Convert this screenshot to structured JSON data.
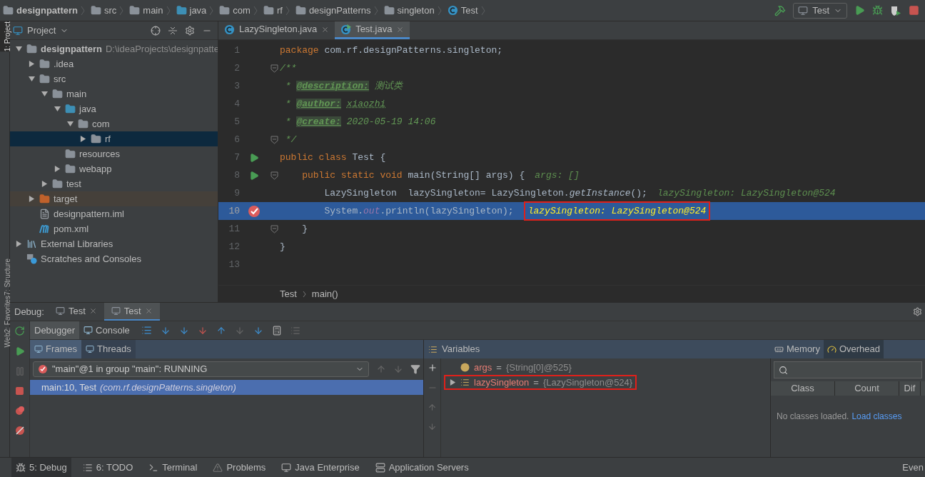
{
  "breadcrumbs": [
    {
      "label": "designpattern",
      "kind": "module"
    },
    {
      "label": "src",
      "kind": "folder"
    },
    {
      "label": "main",
      "kind": "folder"
    },
    {
      "label": "java",
      "kind": "source"
    },
    {
      "label": "com",
      "kind": "package"
    },
    {
      "label": "rf",
      "kind": "package"
    },
    {
      "label": "designPatterns",
      "kind": "package"
    },
    {
      "label": "singleton",
      "kind": "package"
    },
    {
      "label": "Test",
      "kind": "class"
    }
  ],
  "run_config": {
    "label": "Test"
  },
  "side_strip": [
    {
      "label": "1: Project",
      "selected": true
    },
    {
      "label": "7: Structure",
      "selected": false
    },
    {
      "label": "2: Favorites",
      "selected": false
    },
    {
      "label": "Web",
      "selected": false
    }
  ],
  "project": {
    "title": "Project",
    "tree": [
      {
        "label": "designpattern",
        "path": "D:\\ideaProjects\\designpatte",
        "kind": "module",
        "expanded": true,
        "selected": false,
        "children": [
          {
            "label": ".idea",
            "kind": "folder",
            "expanded": false,
            "selected": false
          },
          {
            "label": "src",
            "kind": "folder",
            "expanded": true,
            "selected": false,
            "children": [
              {
                "label": "main",
                "kind": "folder",
                "expanded": true,
                "selected": false,
                "children": [
                  {
                    "label": "java",
                    "kind": "source",
                    "expanded": true,
                    "selected": false,
                    "children": [
                      {
                        "label": "com",
                        "kind": "package",
                        "expanded": true,
                        "selected": false,
                        "children": [
                          {
                            "label": "rf",
                            "kind": "package",
                            "expanded": false,
                            "selected": true
                          }
                        ]
                      }
                    ]
                  },
                  {
                    "label": "resources",
                    "kind": "resources",
                    "selected": false
                  },
                  {
                    "label": "webapp",
                    "kind": "web",
                    "expanded": false,
                    "selected": false
                  }
                ]
              },
              {
                "label": "test",
                "kind": "folder",
                "expanded": false,
                "selected": false
              }
            ]
          },
          {
            "label": "target",
            "kind": "excluded",
            "expanded": false,
            "selected": false
          },
          {
            "label": "designpattern.iml",
            "kind": "iml",
            "selected": false
          },
          {
            "label": "pom.xml",
            "kind": "maven",
            "selected": false
          }
        ]
      },
      {
        "label": "External Libraries",
        "kind": "libraries",
        "expanded": false,
        "selected": false
      },
      {
        "label": "Scratches and Consoles",
        "kind": "scratches",
        "selected": false
      }
    ]
  },
  "editor": {
    "tabs": [
      {
        "label": "LazySingleton.java",
        "kind": "class",
        "selected": false
      },
      {
        "label": "Test.java",
        "kind": "runnable",
        "selected": true
      }
    ],
    "lines": [
      {
        "number": "1",
        "run": false,
        "breakpoint": false,
        "fold": false,
        "selected": false,
        "segments": [
          {
            "text": "package",
            "kind": "keyword"
          },
          {
            "text": " com.rf.designPatterns.singleton;",
            "kind": "plain"
          }
        ]
      },
      {
        "number": "2",
        "run": false,
        "breakpoint": false,
        "fold": true,
        "selected": false,
        "segments": [
          {
            "text": "/**",
            "kind": "doc"
          }
        ]
      },
      {
        "number": "3",
        "run": false,
        "breakpoint": false,
        "fold": false,
        "selected": false,
        "segments": [
          {
            "text": " * ",
            "kind": "doc"
          },
          {
            "text": "@description:",
            "kind": "doc-tag"
          },
          {
            "text": " 测试类",
            "kind": "doc"
          }
        ]
      },
      {
        "number": "4",
        "run": false,
        "breakpoint": false,
        "fold": false,
        "selected": false,
        "segments": [
          {
            "text": " * ",
            "kind": "doc"
          },
          {
            "text": "@author:",
            "kind": "doc-tag"
          },
          {
            "text": "xiaozhi",
            "kind": "doc-underline"
          }
        ]
      },
      {
        "number": "5",
        "run": false,
        "breakpoint": false,
        "fold": false,
        "selected": false,
        "segments": [
          {
            "text": " * ",
            "kind": "doc"
          },
          {
            "text": "@create:",
            "kind": "doc-tag"
          },
          {
            "text": " 2020-05-19 14:06",
            "kind": "doc"
          }
        ]
      },
      {
        "number": "6",
        "run": false,
        "breakpoint": false,
        "fold": true,
        "selected": false,
        "segments": [
          {
            "text": " */",
            "kind": "doc"
          }
        ]
      },
      {
        "number": "7",
        "run": true,
        "breakpoint": false,
        "fold": false,
        "selected": false,
        "segments": [
          {
            "text": "public class",
            "kind": "keyword"
          },
          {
            "text": " Test {",
            "kind": "plain"
          }
        ]
      },
      {
        "number": "8",
        "run": true,
        "breakpoint": false,
        "fold": true,
        "selected": false,
        "segments": [
          {
            "text": "    public static void",
            "kind": "keyword"
          },
          {
            "text": " main(String[] args) {",
            "kind": "plain"
          }
        ],
        "hint": {
          "text": "args: []",
          "boxed": false
        }
      },
      {
        "number": "9",
        "run": false,
        "breakpoint": false,
        "fold": false,
        "selected": false,
        "segments": [
          {
            "text": "        LazySingleton  lazySingleton= LazySingleton.",
            "kind": "plain"
          },
          {
            "text": "getInstance",
            "kind": "static"
          },
          {
            "text": "();",
            "kind": "plain"
          }
        ],
        "hint": {
          "text": "lazySingleton: LazySingleton@524",
          "boxed": false
        }
      },
      {
        "number": "10",
        "run": false,
        "breakpoint": true,
        "fold": false,
        "selected": true,
        "segments": [
          {
            "text": "        System.",
            "kind": "plain"
          },
          {
            "text": "out",
            "kind": "field"
          },
          {
            "text": ".println(lazySingleton);",
            "kind": "plain"
          }
        ],
        "hint": {
          "text": "lazySingleton: LazySingleton@524",
          "boxed": true
        }
      },
      {
        "number": "11",
        "run": false,
        "breakpoint": false,
        "fold": true,
        "selected": false,
        "segments": [
          {
            "text": "    }",
            "kind": "plain"
          }
        ]
      },
      {
        "number": "12",
        "run": false,
        "breakpoint": false,
        "fold": false,
        "selected": false,
        "segments": [
          {
            "text": "}",
            "kind": "plain"
          }
        ]
      },
      {
        "number": "13",
        "run": false,
        "breakpoint": false,
        "fold": false,
        "selected": false
      }
    ],
    "breadcrumbs": [
      "Test",
      "main()"
    ]
  },
  "debug": {
    "title": "Debug:",
    "sessions": [
      {
        "label": "Test",
        "selected": false
      },
      {
        "label": "Test",
        "selected": true
      }
    ],
    "tabs": [
      {
        "label": "Debugger",
        "selected": true
      },
      {
        "label": "Console",
        "selected": false
      }
    ],
    "frames_tabs": [
      {
        "label": "Frames",
        "selected": true
      },
      {
        "label": "Threads",
        "selected": false
      }
    ],
    "thread": "\"main\"@1 in group \"main\": RUNNING",
    "frames": [
      {
        "method": "main:10, Test",
        "package": "(com.rf.designPatterns.singleton)",
        "selected": true
      }
    ],
    "variables_title": "Variables",
    "variables": [
      {
        "name": "args",
        "operator": "=",
        "value": "{String[0]@525}",
        "kind": "param",
        "highlighted": false
      },
      {
        "name": "lazySingleton",
        "operator": "=",
        "value": "{LazySingleton@524}",
        "kind": "field",
        "expanded": false,
        "highlighted": true
      }
    ],
    "memory_tabs": [
      {
        "label": "Memory",
        "selected": false
      },
      {
        "label": "Overhead",
        "selected": true
      }
    ],
    "memory_columns": [
      "Class",
      "Count",
      "Dif"
    ],
    "memory_empty": "No classes loaded.",
    "memory_link": "Load classes"
  },
  "tool_tabs": [
    {
      "label": "5: Debug",
      "kind": "debug",
      "selected": true
    },
    {
      "label": "6: TODO",
      "kind": "todo",
      "selected": false
    },
    {
      "label": "Terminal",
      "kind": "terminal",
      "selected": false
    },
    {
      "label": "Problems",
      "kind": "problems",
      "selected": false
    },
    {
      "label": "Java Enterprise",
      "kind": "enterprise",
      "selected": false
    },
    {
      "label": "Application Servers",
      "kind": "servers",
      "selected": false
    }
  ],
  "event_log": "Even"
}
